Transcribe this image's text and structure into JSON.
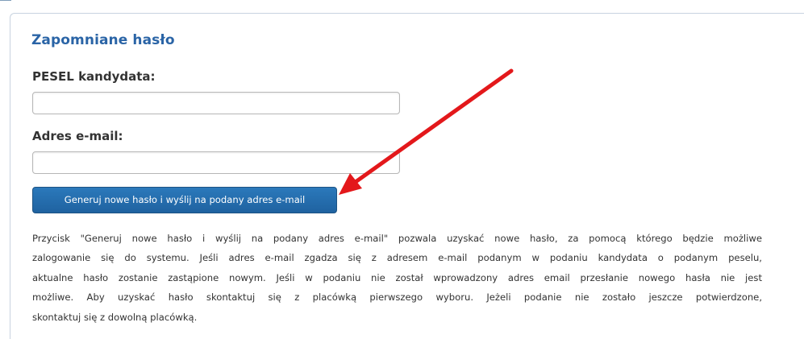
{
  "form": {
    "title": "Zapomniane hasło",
    "pesel_label": "PESEL kandydata:",
    "pesel_value": "",
    "email_label": "Adres e-mail:",
    "email_value": "",
    "generate_button_label": "Generuj nowe hasło i wyślij na podany adres e-mail",
    "description_lines": [
      "Przycisk \"Generuj nowe hasło i wyślij na podany adres e-mail\" pozwala uzyskać nowe hasło, za pomocą którego będzie możliwe",
      "zalogowanie się do systemu. Jeśli adres e-mail zgadza się z adresem e-mail podanym w podaniu kandydata o podanym peselu,",
      "aktualne hasło zostanie zastąpione nowym. Jeśli w podaniu nie został wprowadzony adres email przesłanie nowego hasła nie jest",
      "możliwe. Aby uzyskać hasło skontaktuj się z placówką pierwszego wyboru. Jeżeli podanie nie zostało jeszcze potwierdzone,",
      "skontaktuj się z dowolną placówką."
    ]
  },
  "colors": {
    "title": "#2a64a6",
    "button": "#1f62a0",
    "annotation_arrow": "#e3181b"
  },
  "icons": {
    "annotation": "red-arrow-icon"
  }
}
